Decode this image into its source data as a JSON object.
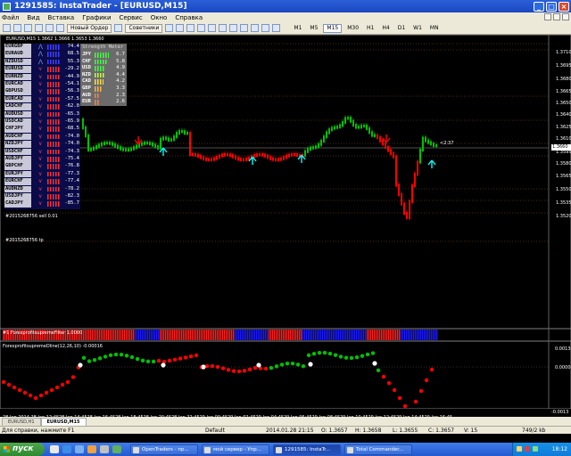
{
  "window": {
    "title": "1291585: InstaTrader - [EURUSD,M15]"
  },
  "menu": [
    "Файл",
    "Вид",
    "Вставка",
    "Графики",
    "Сервис",
    "Окно",
    "Справка"
  ],
  "toolbar": {
    "new_order": "Новый Ордер",
    "advisors": "Советники",
    "timeframes": [
      "M1",
      "M5",
      "M15",
      "M30",
      "H1",
      "H4",
      "D1",
      "W1",
      "MN"
    ],
    "active_timeframe": "M15"
  },
  "chart": {
    "header": "EURUSD,M15 1.3662 1.3666 1.3653 1.3660",
    "price_labels": [
      "1.3710",
      "1.3695",
      "1.3680",
      "1.3665",
      "1.3650",
      "1.3640",
      "1.3625",
      "1.3610",
      "1.3595",
      "1.3580",
      "1.3565",
      "1.3550",
      "1.3535",
      "1.3520"
    ],
    "current_price": "1.3660",
    "price_note": "<2:37",
    "time_labels": [
      "28 Jan 2014",
      "28 Jan 12:45",
      "28 Jan 14:45",
      "28 Jan 16:45",
      "28 Jan 18:45",
      "28 Jan 20:45",
      "28 Jan 22:45",
      "29 Jan 00:45",
      "29 Jan 02:45",
      "29 Jan 04:45",
      "29 Jan 06:45",
      "29 Jan 08:45",
      "29 Jan 10:45",
      "29 Jan 12:45",
      "29 Jan 14:45",
      "29 Jan 16:45"
    ],
    "order_labels": [
      "#2015268756 sell 0.01",
      "#2015268756 tp"
    ],
    "indicator1_label": "#1 ForexprofitsupremeFilter 1.0000",
    "indicator2_label": "ForexprofitsupremeDline(12,26,10) -0.00016",
    "indicator2_axis": [
      "0.0013",
      "0.0000",
      "-0.0013"
    ]
  },
  "currency_meter": {
    "pairs": [
      {
        "pair": "EURGBP",
        "dir": "up",
        "value": "74.4"
      },
      {
        "pair": "EURAUD",
        "dir": "up",
        "value": "68.5"
      },
      {
        "pair": "NZDUSD",
        "dir": "up",
        "value": "55.3"
      },
      {
        "pair": "EURUSD",
        "dir": "down",
        "value": "-29.2"
      },
      {
        "pair": "EURNZD",
        "dir": "down",
        "value": "-44.9"
      },
      {
        "pair": "EURCAD",
        "dir": "down",
        "value": "-54.1"
      },
      {
        "pair": "GBPUSD",
        "dir": "down",
        "value": "-56.3"
      },
      {
        "pair": "EURCAD",
        "dir": "down",
        "value": "-57.5"
      },
      {
        "pair": "CADCHF",
        "dir": "down",
        "value": "-62.0"
      },
      {
        "pair": "AUDUSD",
        "dir": "down",
        "value": "-65.3"
      },
      {
        "pair": "USDCAD",
        "dir": "down",
        "value": "-65.9"
      },
      {
        "pair": "CHFJPY",
        "dir": "down",
        "value": "-68.5"
      },
      {
        "pair": "AUDCHF",
        "dir": "down",
        "value": "-74.0"
      },
      {
        "pair": "NZDJPY",
        "dir": "down",
        "value": "-74.0"
      },
      {
        "pair": "USDCHF",
        "dir": "down",
        "value": "-74.3"
      },
      {
        "pair": "AUDJPY",
        "dir": "down",
        "value": "-75.4"
      },
      {
        "pair": "GBPCHF",
        "dir": "down",
        "value": "-76.8"
      },
      {
        "pair": "EURJPY",
        "dir": "down",
        "value": "-77.3"
      },
      {
        "pair": "EURCHF",
        "dir": "down",
        "value": "-77.4"
      },
      {
        "pair": "AUDNZD",
        "dir": "down",
        "value": "-78.2"
      },
      {
        "pair": "USDJPY",
        "dir": "down",
        "value": "-82.3"
      },
      {
        "pair": "CADJPY",
        "dir": "down",
        "value": "-85.7"
      }
    ]
  },
  "strength_meter": {
    "header": "Strength Meter",
    "rows": [
      {
        "cur": "JPY",
        "value": "6.7"
      },
      {
        "cur": "CHF",
        "value": "5.8"
      },
      {
        "cur": "USD",
        "value": "4.9"
      },
      {
        "cur": "NZD",
        "value": "4.4"
      },
      {
        "cur": "CAD",
        "value": "4.2"
      },
      {
        "cur": "GBP",
        "value": "3.3"
      },
      {
        "cur": "AUD",
        "value": "2.3"
      },
      {
        "cur": "EUR",
        "value": "2.6"
      }
    ]
  },
  "tabs": [
    "EURUSD,H1",
    "EURUSD,M15"
  ],
  "active_tab": "EURUSD,M15",
  "status": {
    "help": "Для справки, нажмите F1",
    "profile": "Default",
    "datetime": "2014.01.28 21:15",
    "open": "O: 1.3657",
    "high": "H: 1.3658",
    "low": "L: 1.3655",
    "close": "C: 1.3657",
    "volume": "V: 15",
    "traffic": "749/2 kb"
  },
  "taskbar": {
    "start": "пуск",
    "tasks": [
      "OpenTraders - пр...",
      "мой сервер - Упр...",
      "1291585: InstaTr...",
      "Total Commander..."
    ],
    "active_task": "1291585: InstaTr...",
    "clock": "18:12"
  },
  "colors": {
    "bull": "#00c000",
    "bear": "#ff0000",
    "signal_up": "#00ffff",
    "grid": "#2a2a2a",
    "blue_band": "#1a1aff"
  }
}
